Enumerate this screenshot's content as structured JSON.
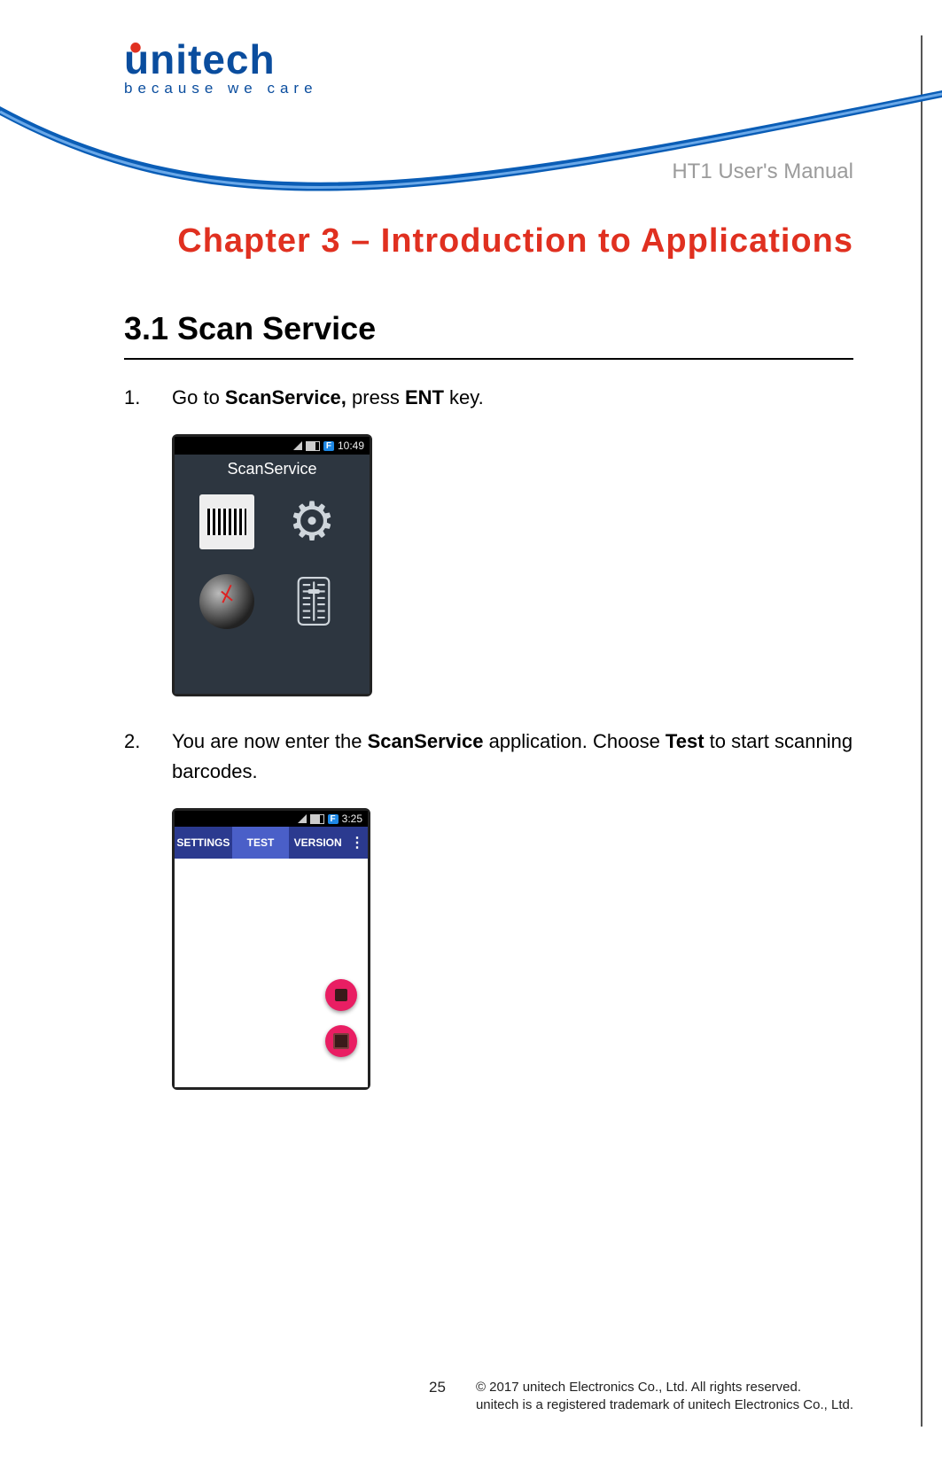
{
  "logo": {
    "brand": "unitech",
    "tagline": "because  we  care"
  },
  "doc_title": "HT1 User's Manual",
  "chapter_title": "Chapter 3 – Introduction to Applications",
  "section_title": "3.1 Scan Service",
  "steps": {
    "s1": {
      "num": "1.",
      "pre": "Go to ",
      "b1": "ScanService,",
      "mid": " press ",
      "b2": "ENT",
      "post": " key."
    },
    "s2": {
      "num": "2.",
      "pre": "You are now enter the ",
      "b1": "ScanService",
      "mid": " application. Choose ",
      "b2": "Test",
      "post": " to start scanning barcodes."
    }
  },
  "phone1": {
    "status_time": "10:49",
    "f_badge": "F",
    "selected_label": "ScanService",
    "icons": {
      "barcode": "barcode-icon",
      "gear": "gear-icon",
      "clock": "clock-icon",
      "sliders": "sliders-icon"
    }
  },
  "phone2": {
    "status_time": "3:25",
    "f_badge": "F",
    "tabs": {
      "settings": "SETTINGS",
      "test": "TEST",
      "version": "VERSION"
    },
    "kebab": "⋮"
  },
  "footer": {
    "page_num": "25",
    "line1": "© 2017 unitech Electronics Co., Ltd. All rights reserved.",
    "line2": "unitech is a registered trademark of unitech Electronics Co., Ltd."
  }
}
